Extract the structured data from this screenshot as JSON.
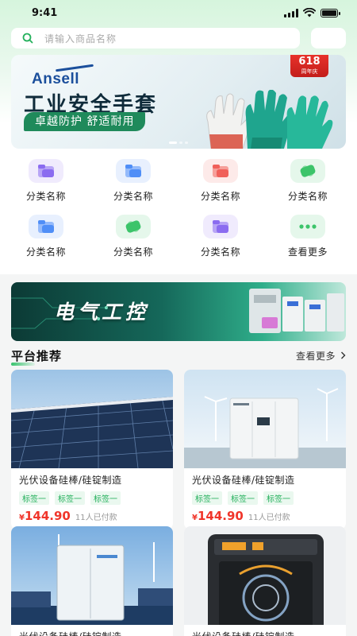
{
  "status_bar": {
    "time": "9:41"
  },
  "search": {
    "placeholder": "请输入商品名称"
  },
  "banner": {
    "brand": "Ansell",
    "title": "工业安全手套",
    "subtitle": "卓越防护 舒适耐用",
    "badge_number": "618",
    "badge_text": "周年庆"
  },
  "categories": [
    {
      "label": "分类名称",
      "icon": "folder-icon",
      "color": "#8b6cf0"
    },
    {
      "label": "分类名称",
      "icon": "folder-icon",
      "color": "#4f8ef7"
    },
    {
      "label": "分类名称",
      "icon": "folder-icon",
      "color": "#f0605a"
    },
    {
      "label": "分类名称",
      "icon": "ticket-icon",
      "color": "#3cc46a"
    },
    {
      "label": "分类名称",
      "icon": "folder-icon",
      "color": "#4f8ef7"
    },
    {
      "label": "分类名称",
      "icon": "ticket-icon",
      "color": "#3cc46a"
    },
    {
      "label": "分类名称",
      "icon": "folder-icon",
      "color": "#8b6cf0"
    },
    {
      "label": "查看更多",
      "icon": "more-icon",
      "color": "#3cc46a"
    }
  ],
  "promo": {
    "title": "电气工控"
  },
  "recommend": {
    "title": "平台推荐",
    "more": "查看更多",
    "products": [
      {
        "title": "光伏设备硅棒/硅锭制造",
        "tags": [
          "标签一",
          "标签一",
          "标签一"
        ],
        "currency": "¥",
        "price": "144.90",
        "sold": "11人已付款",
        "image": "solar-panels"
      },
      {
        "title": "光伏设备硅棒/硅锭制造",
        "tags": [
          "标签一",
          "标签一",
          "标签一"
        ],
        "currency": "¥",
        "price": "144.90",
        "sold": "11人已付款",
        "image": "power-cabinet"
      },
      {
        "title": "光伏设备硅棒/硅锭制造",
        "tags": [],
        "currency": "",
        "price": "",
        "sold": "",
        "image": "energy-storage"
      },
      {
        "title": "光伏设备硅棒/硅锭制造",
        "tags": [],
        "currency": "",
        "price": "",
        "sold": "",
        "image": "inverter"
      }
    ]
  },
  "colors": {
    "accent_green": "#23b05b",
    "price_red": "#f0352a",
    "brand_blue": "#1b4f9c"
  }
}
